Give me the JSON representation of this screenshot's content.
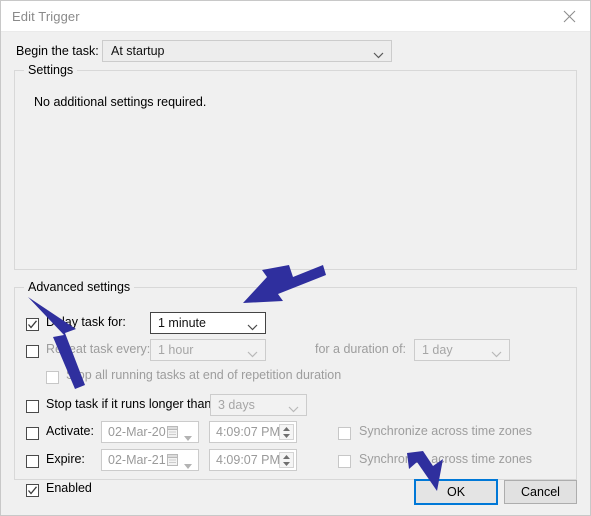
{
  "window": {
    "title": "Edit Trigger",
    "close_icon": "close-icon"
  },
  "begin": {
    "label": "Begin the task:",
    "value": "At startup"
  },
  "settings": {
    "legend": "Settings",
    "note": "No additional settings required."
  },
  "advanced": {
    "legend": "Advanced settings",
    "delay": {
      "label": "Delay task for:",
      "checked": true,
      "value": "1 minute"
    },
    "repeat": {
      "label": "Repeat task every:",
      "checked": false,
      "value": "1 hour",
      "duration_label": "for a duration of:",
      "duration_value": "1 day"
    },
    "stop_repetition": {
      "label": "Stop all running tasks at end of repetition duration",
      "checked": false
    },
    "stop_task": {
      "label": "Stop task if it runs longer than:",
      "checked": false,
      "value": "3 days"
    },
    "activate": {
      "label": "Activate:",
      "checked": false,
      "date": "02-Mar-20",
      "time": "4:09:07 PM",
      "sync_label": "Synchronize across time zones",
      "sync_checked": false
    },
    "expire": {
      "label": "Expire:",
      "checked": false,
      "date": "02-Mar-21",
      "time": "4:09:07 PM",
      "sync_label": "Synchronize across time zones",
      "sync_checked": false
    },
    "enabled": {
      "label": "Enabled",
      "checked": true
    }
  },
  "buttons": {
    "ok": "OK",
    "cancel": "Cancel"
  },
  "annotations": {
    "arrow_color": "#2f2f9e",
    "arrows": [
      {
        "name": "arrow-to-delay-combo",
        "target": "delay-duration-combo"
      },
      {
        "name": "arrow-to-delay-checkbox",
        "target": "delay-task-checkbox"
      },
      {
        "name": "arrow-to-ok-button",
        "target": "ok-button"
      }
    ]
  },
  "colors": {
    "window_background": "#f0f0f0",
    "titlebar_background": "#ffffff",
    "focus_blue": "#0078d7",
    "disabled_text": "#9d9d9d"
  }
}
